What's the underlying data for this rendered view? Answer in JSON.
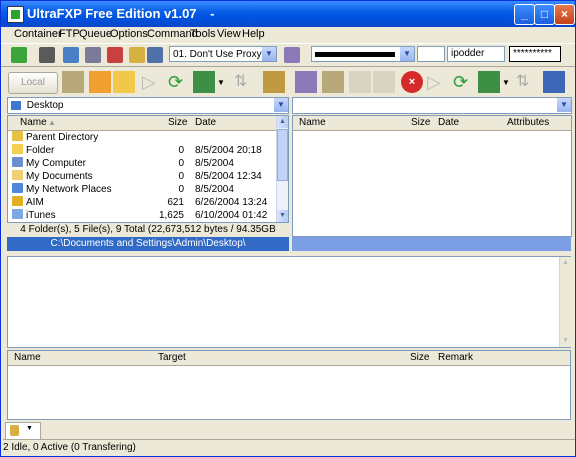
{
  "window": {
    "title": "UltraFXP Free Edition v1.07",
    "title_suffix": "-"
  },
  "menu": [
    "Container",
    "FTP",
    "Queue",
    "Options",
    "Command",
    "Tools",
    "View",
    "Help"
  ],
  "toolbar": {
    "proxy_value": "01. Don't Use Proxy",
    "user_value": "ipodder",
    "password_value": "**********"
  },
  "left": {
    "local_label": "Local",
    "location": "Desktop",
    "columns": {
      "name": "Name",
      "size": "Size",
      "date": "Date"
    },
    "files": [
      {
        "name": "Parent Directory",
        "size": "",
        "date": "",
        "icon": "parent-dir-icon",
        "color": "#e8c040"
      },
      {
        "name": "Folder",
        "size": "0",
        "date": "8/5/2004 20:18",
        "icon": "folder-icon",
        "color": "#f5cf52"
      },
      {
        "name": "My Computer",
        "size": "0",
        "date": "8/5/2004",
        "icon": "computer-icon",
        "color": "#6a8fd0"
      },
      {
        "name": "My Documents",
        "size": "0",
        "date": "8/5/2004 12:34",
        "icon": "documents-icon",
        "color": "#f0d070"
      },
      {
        "name": "My Network Places",
        "size": "0",
        "date": "8/5/2004",
        "icon": "network-icon",
        "color": "#4f88d8"
      },
      {
        "name": "AIM",
        "size": "621",
        "date": "6/26/2004 13:24",
        "icon": "aim-icon",
        "color": "#e0b020"
      },
      {
        "name": "iTunes",
        "size": "1,625",
        "date": "6/10/2004 01:42",
        "icon": "itunes-icon",
        "color": "#7da8e0"
      }
    ],
    "status": "4 Folder(s), 5 File(s), 9 Total (22,673,512 bytes / 94.35GB Free)",
    "path": "C:\\Documents and Settings\\Admin\\Desktop\\"
  },
  "right": {
    "columns": {
      "name": "Name",
      "size": "Size",
      "date": "Date",
      "attributes": "Attributes"
    }
  },
  "queue": {
    "columns": {
      "name": "Name",
      "target": "Target",
      "size": "Size",
      "remark": "Remark"
    }
  },
  "status_text": "2 Idle, 0 Active (0 Transfering)",
  "colors": {
    "title_blue": "#0054e3",
    "selection_blue": "#316ac5"
  }
}
